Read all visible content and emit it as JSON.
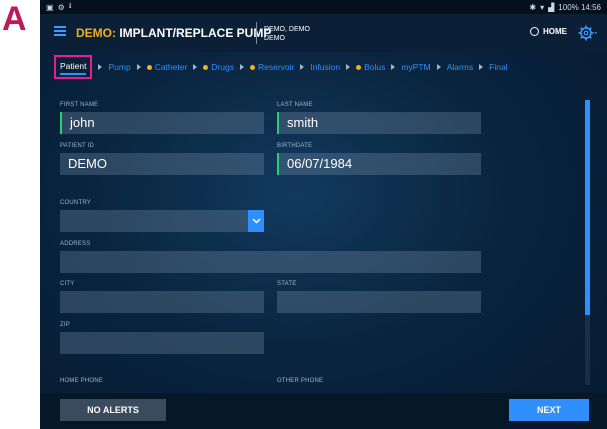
{
  "figure_label": "A",
  "statusbar": {
    "right_text": "100% 14:56"
  },
  "appbar": {
    "title_prefix": "DEMO:",
    "title_main": " IMPLANT/REPLACE PUMP",
    "patient_line1": "DEMO, DEMO",
    "patient_line2": "DEMO",
    "home_label": "HOME"
  },
  "tabs": [
    {
      "label": "Patient",
      "active": true
    },
    {
      "label": "Pump",
      "dot": false
    },
    {
      "label": "Catheter",
      "dot": true
    },
    {
      "label": "Drugs",
      "dot": true
    },
    {
      "label": "Reservoir",
      "dot": true
    },
    {
      "label": "Infusion",
      "dot": false
    },
    {
      "label": "Bolus",
      "dot": true
    },
    {
      "label": "myPTM",
      "dot": false
    },
    {
      "label": "Alarms",
      "dot": false
    },
    {
      "label": "Final",
      "dot": false
    }
  ],
  "form": {
    "first_name_label": "FIRST NAME",
    "first_name_value": "john",
    "last_name_label": "LAST NAME",
    "last_name_value": "smith",
    "patient_id_label": "PATIENT ID",
    "patient_id_value": "DEMO",
    "birthdate_label": "BIRTHDATE",
    "birthdate_value": "06/07/1984",
    "country_label": "COUNTRY",
    "country_value": "",
    "address_label": "ADDRESS",
    "city_label": "CITY",
    "state_label": "STATE",
    "zip_label": "ZIP",
    "home_phone_label": "HOME PHONE",
    "other_phone_label": "OTHER PHONE"
  },
  "footer": {
    "no_alerts_label": "NO ALERTS",
    "next_label": "NEXT"
  },
  "colors": {
    "accent_blue": "#2f8fff",
    "demo_yellow": "#f2b01e",
    "highlight_pink": "#e91e8c",
    "field_accent_green": "#2ecc71"
  }
}
